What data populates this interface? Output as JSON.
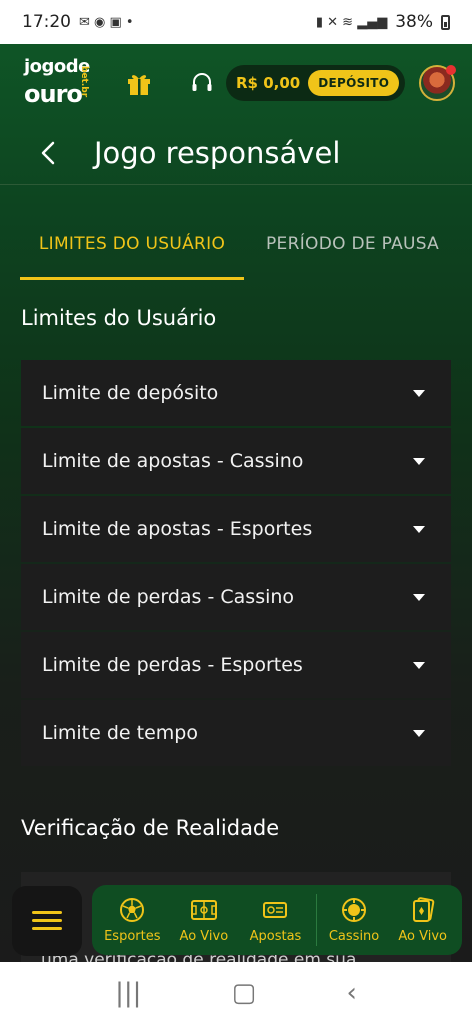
{
  "status_bar": {
    "time": "17:20",
    "battery": "38%"
  },
  "header": {
    "logo_line1": "jogode",
    "logo_line2": "ouro",
    "logo_suffix": "bet.br",
    "balance": "R$ 0,00",
    "deposit_label": "DEPÓSITO"
  },
  "page": {
    "title": "Jogo responsável"
  },
  "tabs": [
    {
      "label": "LIMITES DO USUÁRIO",
      "active": true
    },
    {
      "label": "PERÍODO DE PAUSA",
      "active": false
    }
  ],
  "limits_section": {
    "title": "Limites do Usuário",
    "items": [
      {
        "label": "Limite de depósito"
      },
      {
        "label": "Limite de apostas - Cassino"
      },
      {
        "label": "Limite de apostas - Esportes"
      },
      {
        "label": "Limite de perdas - Cassino"
      },
      {
        "label": "Limite de perdas - Esportes"
      },
      {
        "label": "Limite de tempo"
      }
    ]
  },
  "reality_section": {
    "title": "Verificação de Realidade",
    "partial_text": "uma verificação de realidade em sua"
  },
  "bottom_nav": {
    "items": [
      {
        "label": "Esportes",
        "icon": "soccer-ball-icon"
      },
      {
        "label": "Ao Vivo",
        "icon": "field-icon"
      },
      {
        "label": "Apostas",
        "icon": "ticket-icon"
      },
      {
        "label": "Cassino",
        "icon": "poker-chip-icon"
      },
      {
        "label": "Ao Vivo",
        "icon": "cards-icon"
      }
    ]
  },
  "colors": {
    "accent": "#f0c419",
    "brand_green": "#0f5526",
    "nav_bg": "#0f4d22"
  }
}
